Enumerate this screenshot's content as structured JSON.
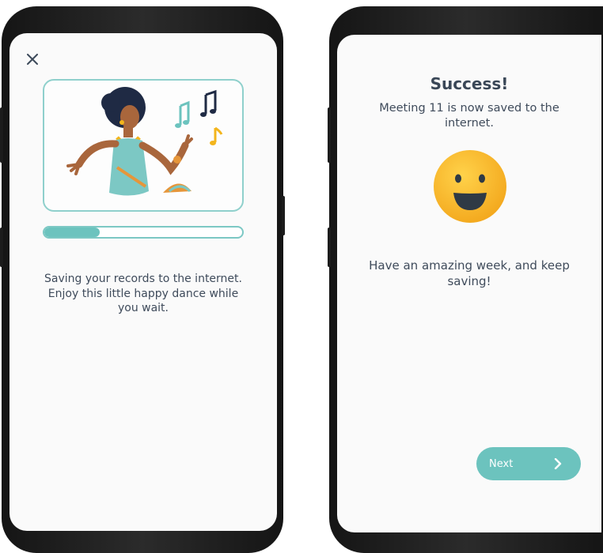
{
  "left_screen": {
    "close_icon": "close-icon",
    "illustration": "dancing-woman-with-music-notes",
    "progress": 0.28,
    "saving_message": "Saving your records to the internet. Enjoy this little happy dance while you wait."
  },
  "right_screen": {
    "title": "Success!",
    "saved_message": "Meeting 11 is now saved to the internet.",
    "emoji": "smiley-face",
    "week_message": "Have an amazing week, and keep saving!",
    "next_button": {
      "label": "Next",
      "icon": "chevron-right-icon"
    }
  },
  "colors": {
    "accent": "#6cc3be",
    "card_border": "#8fd0cc",
    "text": "#3f4b5b",
    "smiley_yellow": "#f7b930"
  }
}
